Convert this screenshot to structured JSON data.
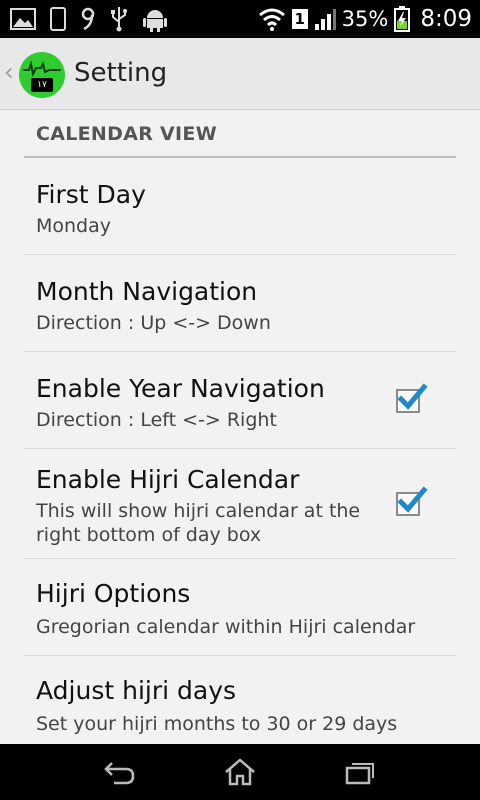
{
  "status_bar": {
    "sim_indicator": "1",
    "battery_percent": "35%",
    "time": "8:09",
    "left_icons": [
      "image-icon",
      "phone-icon",
      "notification-icon",
      "usb-icon",
      "android-debug-icon"
    ],
    "right_icons": [
      "wifi-icon",
      "sim-icon",
      "signal-icon",
      "battery-charging-icon"
    ]
  },
  "action_bar": {
    "title": "Setting",
    "app_icon_badge": "١٧",
    "accent_color": "#2ecc2e"
  },
  "section": {
    "header": "CALENDAR VIEW"
  },
  "preferences": [
    {
      "title": "First Day",
      "summary": "Monday"
    },
    {
      "title": "Month Navigation",
      "summary": "Direction : Up <-> Down"
    },
    {
      "title": "Enable Year Navigation",
      "summary": "Direction : Left <-> Right",
      "checked": true
    },
    {
      "title": "Enable Hijri Calendar",
      "summary": "This will show hijri calendar at the right bottom of day box",
      "checked": true
    },
    {
      "title": "Hijri Options",
      "summary": "Gregorian calendar within Hijri calendar"
    },
    {
      "title": "Adjust hijri days",
      "summary": "Set your hijri months to 30 or 29 days"
    }
  ],
  "checkbox_color": "#1e88c8",
  "nav_bar": {
    "buttons": [
      "back-icon",
      "home-icon",
      "recent-apps-icon"
    ]
  }
}
